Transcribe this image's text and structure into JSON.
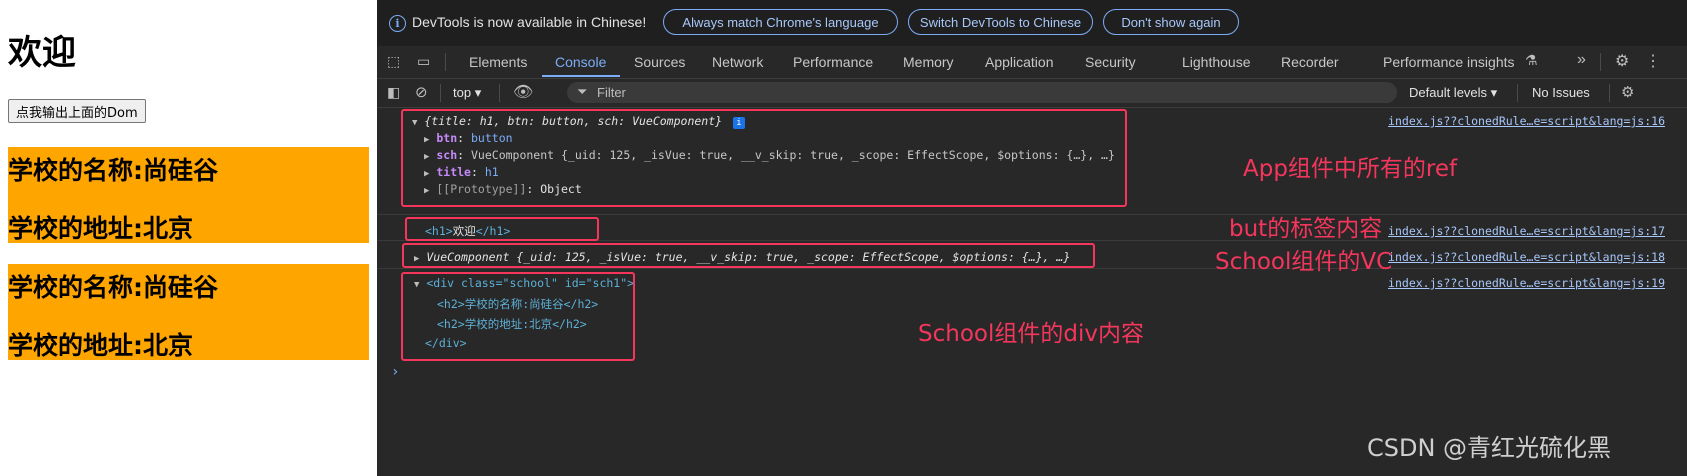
{
  "app": {
    "heading": "欢迎",
    "button_label": "点我输出上面的Dom",
    "schools": [
      {
        "name": "学校的名称:尚硅谷",
        "address": "学校的地址:北京"
      },
      {
        "name": "学校的名称:尚硅谷",
        "address": "学校的地址:北京"
      }
    ]
  },
  "devtools": {
    "infobar": {
      "message": "DevTools is now available in Chinese!",
      "buttons": [
        "Always match Chrome's language",
        "Switch DevTools to Chinese",
        "Don't show again"
      ]
    },
    "tabs": [
      "Elements",
      "Console",
      "Sources",
      "Network",
      "Performance",
      "Memory",
      "Application",
      "Security",
      "Lighthouse",
      "Recorder",
      "Performance insights"
    ],
    "active_tab": "Console",
    "toolbar": {
      "context": "top",
      "filter_placeholder": "Filter",
      "levels": "Default levels",
      "issues": "No Issues"
    },
    "console": {
      "entry1": {
        "summary": "{title: h1, btn: button, sch: VueComponent}",
        "info_badge": "i",
        "btn_key": "btn",
        "btn_val": "button",
        "sch_key": "sch",
        "sch_val": "VueComponent  {_uid: 125, _isVue: true, __v_skip: true, _scope: EffectScope, $options: {…},  …}",
        "title_key": "title",
        "title_val": "h1",
        "proto_key": "[[Prototype]]",
        "proto_val": "Object",
        "source": "index.js??clonedRule…e=script&lang=js:16"
      },
      "entry2": {
        "open_tag": "<h1>",
        "text": "欢迎",
        "close_tag": "</h1>",
        "source": "index.js??clonedRule…e=script&lang=js:17"
      },
      "entry3": {
        "text": "VueComponent  {_uid: 125, _isVue: true, __v_skip: true, _scope: EffectScope, $options: {…},  …}",
        "source": "index.js??clonedRule…e=script&lang=js:18"
      },
      "entry4": {
        "line1": "<div class=\"school\" id=\"sch1\">",
        "line2": "<h2>学校的名称:尚硅谷</h2>",
        "line3": "<h2>学校的地址:北京</h2>",
        "line4": "</div>",
        "source": "index.js??clonedRule…e=script&lang=js:19"
      },
      "prompt": "›"
    }
  },
  "annotations": {
    "a1": "App组件中所有的ref",
    "a2": "but的标签内容",
    "a3": "School组件的VC",
    "a4": "School组件的div内容"
  },
  "watermark": "CSDN @青红光硫化黑",
  "colors": {
    "school_bg": "#ffa500",
    "annotation_red": "#f5365c",
    "devtools_bg": "#282828",
    "accent_blue": "#7cacf8"
  }
}
